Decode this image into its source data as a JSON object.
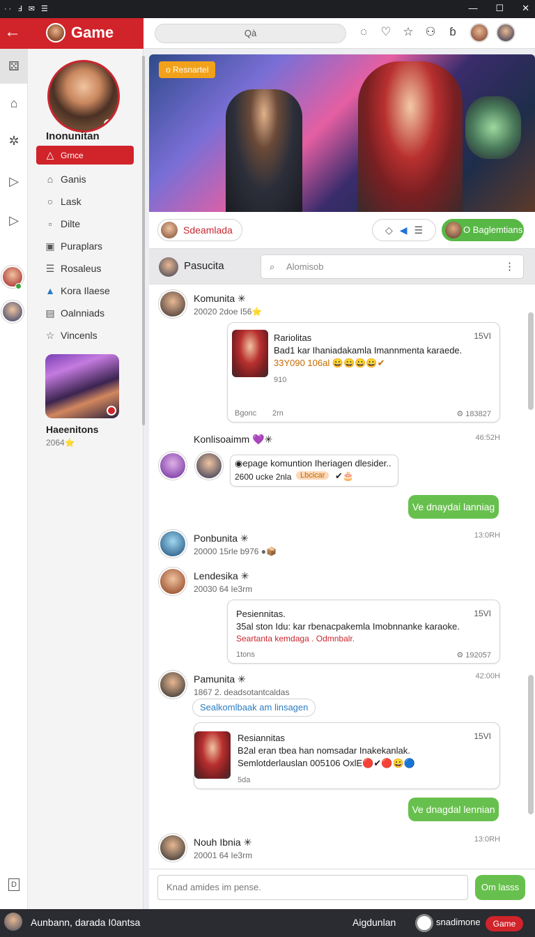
{
  "statusbar": {
    "left_icons": "·· Ⅎ ✉ ☰",
    "minimize": "—",
    "maximize": "☐",
    "close": "✕"
  },
  "app": {
    "title": "Game",
    "back_icon": "arrow-left-icon",
    "accent": "#d1232a"
  },
  "topbar": {
    "search_text": "Qà",
    "icons": [
      "chat-bubble-icon",
      "heart-icon",
      "star-icon",
      "controller-icon",
      "bag-icon"
    ]
  },
  "rail": {
    "bottom_icon": "D"
  },
  "sidebar": {
    "profile_name": "Inonunitan",
    "items": [
      {
        "icon": "△",
        "label": "Grnce",
        "active": true
      },
      {
        "icon": "⌂",
        "label": "Ganis"
      },
      {
        "icon": "○",
        "label": "Lask"
      },
      {
        "icon": "▫",
        "label": "Dilte"
      },
      {
        "icon": "▣",
        "label": "Puraplars"
      },
      {
        "icon": "☰",
        "label": "Rosaleus"
      },
      {
        "icon": "▲",
        "label": "Kora Ilaese"
      },
      {
        "icon": "▤",
        "label": "Oalnniads"
      },
      {
        "icon": "☆",
        "label": "Vincenls"
      }
    ],
    "card_name": "Haeenitons",
    "card_sub": "2064⭐"
  },
  "banner": {
    "tag": "o Resnartel"
  },
  "bar1": {
    "left_pill": "Sdeamlada",
    "right_pill": "O Baglemtians",
    "mid_icons": [
      "◇",
      "◀",
      "☰"
    ]
  },
  "bar2": {
    "label": "Pasucita",
    "search_placeholder": "Alomisob",
    "search_icon": "⌕",
    "more_icon": "⋮"
  },
  "messages": {
    "m1": {
      "name": "Komunita ✳",
      "sub": "20020 2doe I56⭐"
    },
    "b1": {
      "title": "Rariolitas",
      "time": "15VI",
      "line1": "Bad1 kar Ihaniadakamla Imannmenta karaede.",
      "line2": "33Y090 106al 😀😀😀😀✔",
      "line3": "910",
      "footer_left": "Bgonc",
      "footer_mid": "2rn",
      "footer_right": "⚙ 183827"
    },
    "m2": {
      "name": "Konlisoaimm 💜✳",
      "time": "46:52H"
    },
    "m3": {
      "line1": "◉epage komuntion Iheriagen dlesider..",
      "line2": "2600 ucke 2nla",
      "chip": "Lbcicar",
      "emoji": "✔🎂"
    },
    "g1": "Ve dnaydai lanniag",
    "m4": {
      "name": "Ponbunita ✳",
      "sub": "20000 15rle b976 ●📦",
      "time": "13:0RH"
    },
    "m5": {
      "name": "Lendesika ✳",
      "sub": "20030 64 Ie3rm"
    },
    "b2": {
      "title": "Pesiennitas.",
      "time": "15VI",
      "line1": "35al ston Idu: kar rbenacpakemla Imobnnanke karaoke.",
      "line2": "Seartanta kemdaga . Odmnbalr.",
      "line3": "1tons",
      "footer_right": "⚙ 192057"
    },
    "m6": {
      "name": "Pamunita ✳",
      "sub": "1867 2. deadsotantcaldas",
      "chip": "Sealkomlbaak am linsagen",
      "time": "42:00H"
    },
    "b3": {
      "title": "Resiannitas",
      "time": "15VI",
      "line1": "B2al eran tbea han nomsadar Inakekanlak.",
      "line2": "Semlotderlauslan 005106 OxlE🔴✔🔴😀🔵",
      "line3": "5da"
    },
    "g2": "Ve dnagdal lennian",
    "m7": {
      "name": "Nouh Ibnia ✳",
      "sub": "20001 64 Ie3rm",
      "time": "13:0RH"
    }
  },
  "composer": {
    "placeholder": "Knad amides im pense.",
    "send": "Om lasss"
  },
  "bottombar": {
    "left": "Aunbann,  darada I0antsa",
    "mid": "Aigdunlan",
    "right": "snadimone",
    "button": "Game"
  }
}
